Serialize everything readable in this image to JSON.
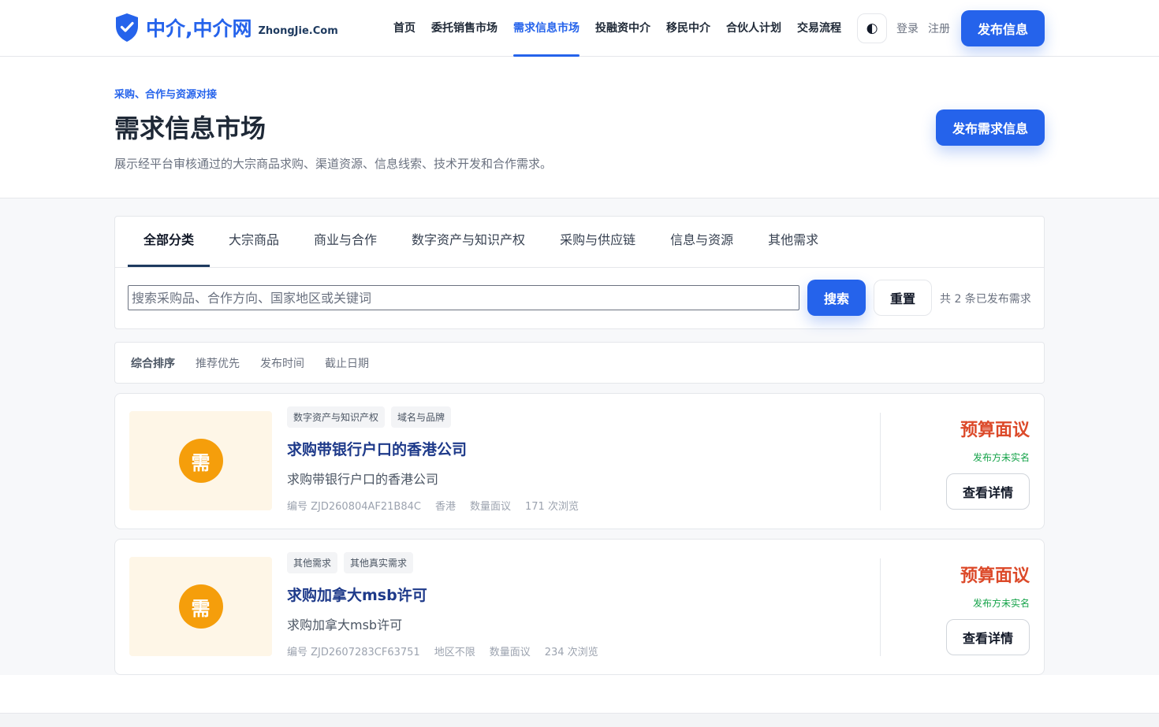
{
  "header": {
    "logo_cn": "中介,中介网",
    "logo_en": "ZhongJie.Com",
    "nav": [
      {
        "label": "首页",
        "active": false
      },
      {
        "label": "委托销售市场",
        "active": false
      },
      {
        "label": "需求信息市场",
        "active": true
      },
      {
        "label": "投融资中介",
        "active": false
      },
      {
        "label": "移民中介",
        "active": false
      },
      {
        "label": "合伙人计划",
        "active": false
      },
      {
        "label": "交易流程",
        "active": false
      }
    ],
    "theme_icon": "◐",
    "login": "登录",
    "register": "注册",
    "publish": "发布信息"
  },
  "hero": {
    "eyebrow": "采购、合作与资源对接",
    "title": "需求信息市场",
    "description": "展示经平台审核通过的大宗商品求购、渠道资源、信息线索、技术开发和合作需求。",
    "publish_button": "发布需求信息"
  },
  "filters": {
    "tabs": [
      "全部分类",
      "大宗商品",
      "商业与合作",
      "数字资产与知识产权",
      "采购与供应链",
      "信息与资源",
      "其他需求"
    ],
    "active_tab": 0,
    "search_placeholder": "搜索采购品、合作方向、国家地区或关键词",
    "search_button": "搜索",
    "reset_button": "重置",
    "count_text": "共 2 条已发布需求"
  },
  "sort": {
    "options": [
      "综合排序",
      "推荐优先",
      "发布时间",
      "截止日期"
    ],
    "active": 0
  },
  "items": [
    {
      "thumb_char": "需",
      "tags": [
        "数字资产与知识产权",
        "域名与品牌"
      ],
      "title": "求购带银行户口的香港公司",
      "description": "求购带银行户口的香港公司",
      "code": "编号 ZJD260804AF21B84C",
      "region": "香港",
      "quantity": "数量面议",
      "views": "171 次浏览",
      "budget": "预算面议",
      "publisher": "发布方未实名",
      "detail_button": "查看详情"
    },
    {
      "thumb_char": "需",
      "tags": [
        "其他需求",
        "其他真实需求"
      ],
      "title": "求购加拿大msb许可",
      "description": "求购加拿大msb许可",
      "code": "编号 ZJD2607283CF63751",
      "region": "地区不限",
      "quantity": "数量面议",
      "views": "234 次浏览",
      "budget": "预算面议",
      "publisher": "发布方未实名",
      "detail_button": "查看详情"
    }
  ],
  "colors": {
    "brand": "#2563eb",
    "budget": "#dc4a2a",
    "publisher": "#16a34a",
    "thumb_bg": "#fef6e7",
    "thumb_circle": "#f59e0b"
  }
}
